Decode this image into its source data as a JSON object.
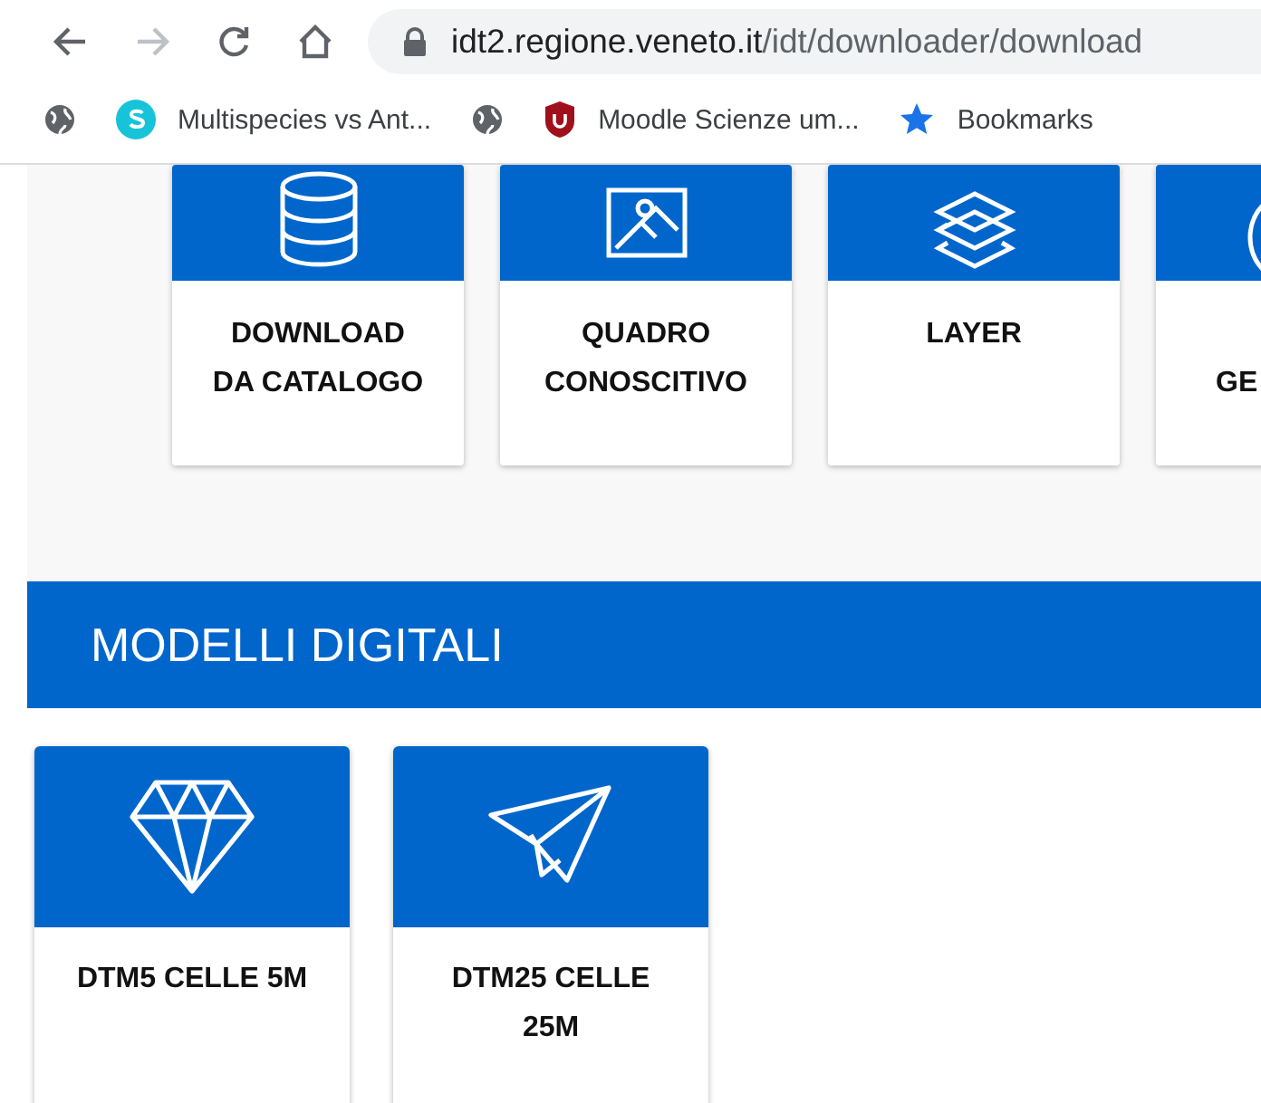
{
  "address_bar": {
    "host": "idt2.regione.veneto.it",
    "path": "/idt/downloader/download"
  },
  "nav_buttons": [
    {
      "kind": "back",
      "disabled": false
    },
    {
      "kind": "forward",
      "disabled": true
    },
    {
      "kind": "reload",
      "disabled": false
    },
    {
      "kind": "home",
      "disabled": false
    }
  ],
  "bookmarks": [
    {
      "kind": "globe"
    },
    {
      "kind": "s",
      "label": "Multispecies vs Ant..."
    },
    {
      "kind": "globe"
    },
    {
      "kind": "shield",
      "label": "Moodle Scienze um..."
    },
    {
      "kind": "star",
      "label": "Bookmarks"
    }
  ],
  "top_cards": [
    {
      "kind": "database",
      "lines": [
        "DOWNLOAD",
        "DA CATALOGO"
      ]
    },
    {
      "kind": "image",
      "lines": [
        "QUADRO",
        "CONOSCITIVO"
      ]
    },
    {
      "kind": "layers",
      "lines": [
        "LAYER"
      ]
    },
    {
      "kind": "globe",
      "lines": [
        "GE"
      ]
    }
  ],
  "section": {
    "title": "MODELLI DIGITALI"
  },
  "model_cards": [
    {
      "kind": "diamond",
      "lines": [
        "DTM5 CELLE 5M"
      ]
    },
    {
      "kind": "plane",
      "lines": [
        "DTM25 CELLE",
        "25M"
      ]
    }
  ]
}
